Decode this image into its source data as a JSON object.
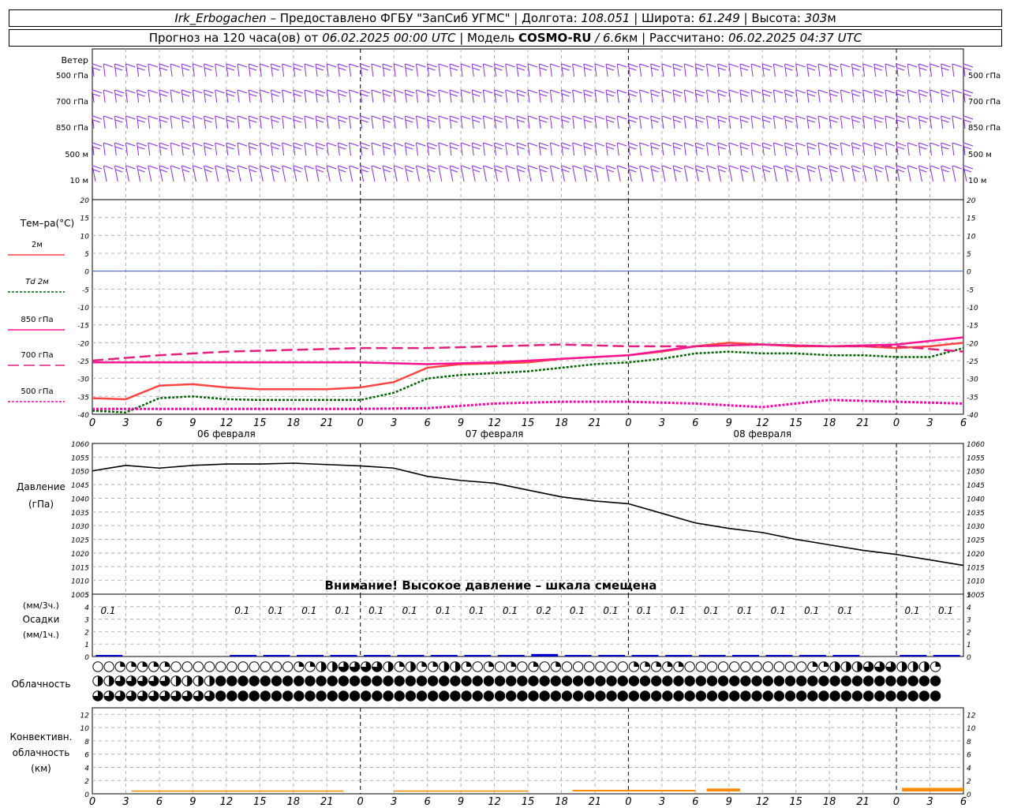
{
  "header": {
    "line1": {
      "station": "Irk_Erbogachen",
      "provider": " – Предоставлено ФГБУ \"ЗапСиб УГМС\" | Долгота: ",
      "longitude": "108.051",
      "lat_label": " | Широта: ",
      "latitude": "61.249",
      "alt_label": " | Высота: ",
      "altitude": "303",
      "alt_unit": "м"
    },
    "line2": {
      "forecast_label": "Прогноз на 120 часа(ов) от ",
      "forecast_start": "06.02.2025 00:00 UTC",
      "model_label": "  | Модель ",
      "model_name": "COSMO-RU",
      "model_sep": " / ",
      "model_res": "6.6",
      "model_res_unit": "км",
      "calc_label": " | Рассчитано: ",
      "calc_time": "06.02.2025 04:37 UTC"
    }
  },
  "time_axis": {
    "hour_labels": [
      "0",
      "3",
      "6",
      "9",
      "12",
      "15",
      "18",
      "21",
      "0",
      "3",
      "6",
      "9",
      "12",
      "15",
      "18",
      "21",
      "0",
      "3",
      "6",
      "9",
      "12",
      "15",
      "18",
      "21",
      "0",
      "3",
      "6"
    ],
    "date_labels": [
      "06 февраля",
      "07 февраля",
      "08 февраля"
    ]
  },
  "wind_panel": {
    "title": "Ветер",
    "levels": [
      "500 гПа",
      "700 гПа",
      "850 гПа",
      "500 м",
      "10 м"
    ],
    "barb_color": "#8a2be2"
  },
  "chart_data": [
    {
      "type": "line",
      "title": "Тем–ра(°C)",
      "ylim": [
        -40,
        20
      ],
      "yticks": [
        20,
        15,
        10,
        5,
        0,
        -5,
        -10,
        -15,
        -20,
        -25,
        -30,
        -35,
        -40
      ],
      "x_unit": "hours since 06.02.2025 00:00 UTC",
      "grid": true,
      "series": [
        {
          "name": "2м",
          "color": "#ff4444",
          "style": "solid",
          "x": [
            0,
            3,
            6,
            9,
            12,
            15,
            18,
            21,
            24,
            27,
            30,
            33,
            36,
            39,
            42,
            45,
            48,
            51,
            54,
            57,
            60,
            63,
            66,
            69,
            72,
            75,
            78
          ],
          "values": [
            -35.5,
            -35.8,
            -32.0,
            -31.6,
            -32.5,
            -33.0,
            -33.0,
            -33.0,
            -32.5,
            -31.0,
            -27.0,
            -26.0,
            -25.8,
            -25.5,
            -24.5,
            -24.0,
            -23.5,
            -22.5,
            -21.0,
            -20.0,
            -20.5,
            -21.0,
            -21.0,
            -21.0,
            -21.5,
            -21.0,
            -20.0
          ]
        },
        {
          "name": "Td 2м",
          "color": "#006400",
          "style": "dotted",
          "x": [
            0,
            3,
            6,
            9,
            12,
            15,
            18,
            21,
            24,
            27,
            30,
            33,
            36,
            39,
            42,
            45,
            48,
            51,
            54,
            57,
            60,
            63,
            66,
            69,
            72,
            75,
            78
          ],
          "values": [
            -39.0,
            -39.5,
            -35.5,
            -35.0,
            -35.8,
            -36.0,
            -36.0,
            -36.0,
            -36.0,
            -34.0,
            -30.0,
            -29.0,
            -28.5,
            -28.0,
            -27.0,
            -26.0,
            -25.5,
            -24.5,
            -23.0,
            -22.5,
            -23.0,
            -23.0,
            -23.5,
            -23.5,
            -24.0,
            -24.0,
            -21.5
          ]
        },
        {
          "name": "850 гПа",
          "color": "#ff1493",
          "style": "solid",
          "x": [
            0,
            6,
            12,
            18,
            24,
            30,
            36,
            42,
            48,
            54,
            60,
            66,
            72,
            78
          ],
          "values": [
            -25.5,
            -25.5,
            -25.5,
            -25.5,
            -25.5,
            -26.0,
            -25.5,
            -24.5,
            -23.5,
            -21.0,
            -20.5,
            -21.0,
            -20.5,
            -18.5
          ]
        },
        {
          "name": "700 гПа",
          "color": "#e0207f",
          "style": "dashed",
          "x": [
            0,
            6,
            12,
            18,
            24,
            30,
            36,
            42,
            48,
            54,
            60,
            66,
            72,
            78
          ],
          "values": [
            -25.0,
            -23.5,
            -22.5,
            -22.0,
            -21.5,
            -21.5,
            -21.0,
            -20.5,
            -21.0,
            -21.0,
            -20.5,
            -21.0,
            -21.0,
            -22.5
          ]
        },
        {
          "name": "500 гПа",
          "color": "#ff00aa",
          "style": "dotted",
          "x": [
            0,
            6,
            12,
            18,
            24,
            30,
            36,
            42,
            48,
            54,
            60,
            66,
            72,
            78
          ],
          "values": [
            -38.5,
            -38.5,
            -38.5,
            -38.5,
            -38.5,
            -38.3,
            -37.0,
            -36.5,
            -36.5,
            -37.0,
            -38.0,
            -36.0,
            -36.5,
            -37.0
          ]
        }
      ]
    },
    {
      "type": "line",
      "title": "Давление",
      "ylabel": "(гПа)",
      "ylim": [
        1005,
        1060
      ],
      "yticks": [
        1060,
        1055,
        1050,
        1045,
        1040,
        1035,
        1030,
        1025,
        1020,
        1015,
        1010,
        1005
      ],
      "grid": true,
      "annotation": "Внимание! Высокое давление – шкала смещена",
      "series": [
        {
          "color": "#000000",
          "x": [
            0,
            3,
            6,
            9,
            12,
            15,
            18,
            21,
            24,
            27,
            30,
            33,
            36,
            39,
            42,
            45,
            48,
            51,
            54,
            57,
            60,
            63,
            66,
            69,
            72,
            75,
            78
          ],
          "values": [
            1050.0,
            1052.0,
            1051.0,
            1052.0,
            1052.5,
            1052.5,
            1052.8,
            1052.3,
            1051.8,
            1051.0,
            1048.0,
            1046.5,
            1045.5,
            1043.0,
            1040.5,
            1039.0,
            1038.0,
            1034.5,
            1031.0,
            1029.0,
            1027.5,
            1025.0,
            1023.0,
            1021.0,
            1019.5,
            1017.5,
            1015.5
          ]
        }
      ]
    },
    {
      "type": "bar",
      "title": "Осадки",
      "ylabel_top": "(мм/3ч.)",
      "ylabel_bottom": "(мм/1ч.)",
      "ylim": [
        0,
        5
      ],
      "yticks": [
        5,
        4,
        3,
        2,
        1,
        0
      ],
      "color": "#0000cc",
      "x": [
        0,
        3,
        6,
        9,
        12,
        15,
        18,
        21,
        24,
        27,
        30,
        33,
        36,
        39,
        42,
        45,
        48,
        51,
        54,
        57,
        60,
        63,
        66,
        69,
        72,
        75,
        78
      ],
      "values": [
        0.1,
        null,
        null,
        null,
        0.1,
        0.1,
        0.1,
        0.1,
        0.1,
        0.1,
        0.1,
        0.1,
        0.1,
        0.2,
        0.1,
        0.1,
        0.1,
        0.1,
        0.1,
        0.1,
        0.1,
        0.1,
        0.1,
        null,
        0.1,
        0.1,
        null
      ],
      "labels": [
        "0.1",
        "",
        "",
        "",
        "0.1",
        "0.1",
        "0.1",
        "0.1",
        "0.1",
        "0.1",
        "0.1",
        "0.1",
        "0.1",
        "0.2",
        "0.1",
        "0.1",
        "0.1",
        "0.1",
        "0.1",
        "0.1",
        "0.1",
        "0.1",
        "0.1",
        "",
        "0.1",
        "0.1",
        ""
      ]
    },
    {
      "type": "area",
      "title": "Конвективн. облачность",
      "ylabel": "(км)",
      "ylim": [
        0,
        13
      ],
      "yticks": [
        12,
        10,
        8,
        6,
        4,
        2,
        0
      ],
      "color": "#ff8c00",
      "segments": [
        {
          "x": [
            3.5,
            22.5
          ],
          "value": 0.5
        },
        {
          "x": [
            27,
            39
          ],
          "value": 0.5
        },
        {
          "x": [
            43,
            54
          ],
          "value": 0.6
        },
        {
          "x": [
            55,
            58
          ],
          "value": 0.8
        },
        {
          "x": [
            72.5,
            78
          ],
          "value": 0.9
        }
      ]
    }
  ],
  "cloud_panel": {
    "title": "Облачность",
    "rows": [
      {
        "name": "high",
        "pattern": "0011111000000000001122333321211221010101010000001111100000000000112223332221"
      },
      {
        "name": "mid",
        "pattern": "2233333222244444444444444444444444444444444444444444444444444444444444444444"
      },
      {
        "name": "low",
        "pattern": "3333333333344444444444444444444444444444444444444444444444444444444444444444"
      }
    ]
  }
}
